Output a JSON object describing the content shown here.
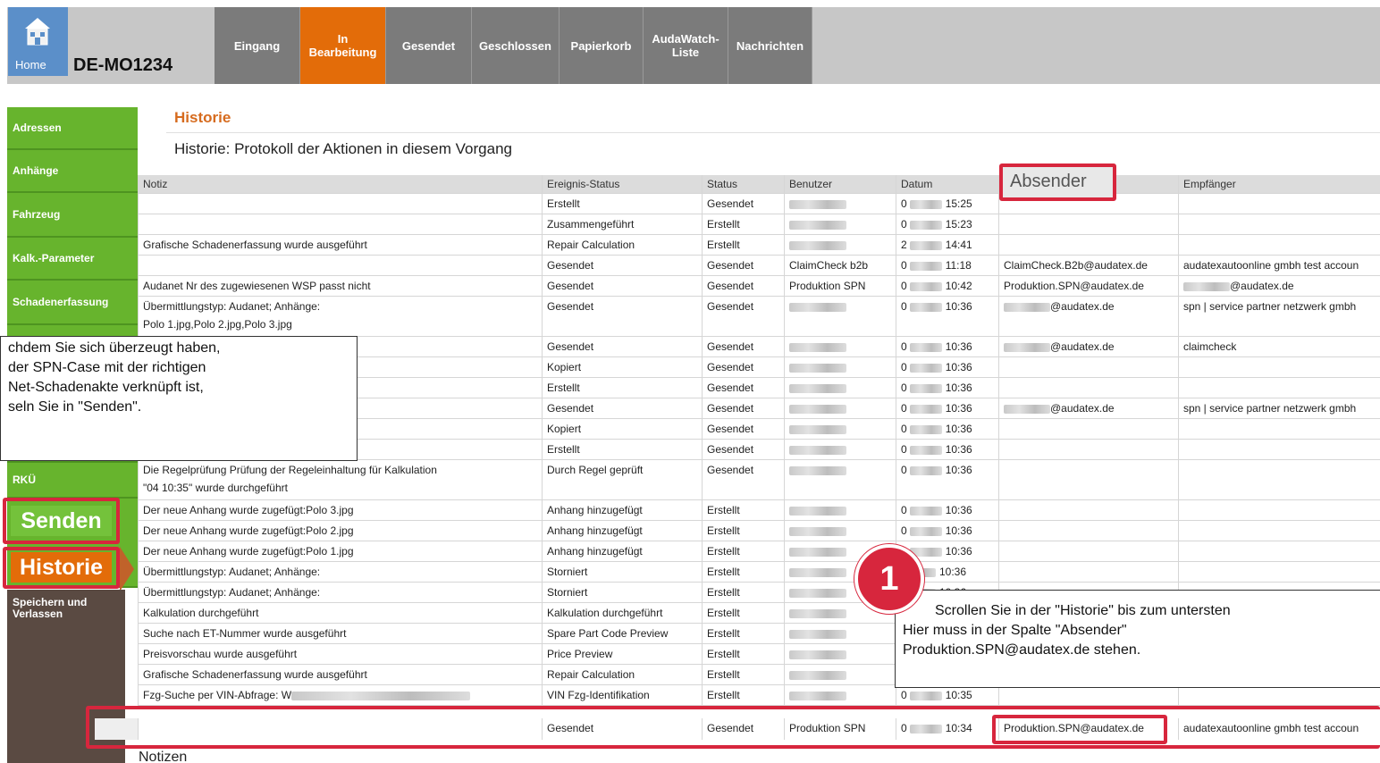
{
  "home_label": "Home",
  "case_id": "DE-MO1234",
  "nav_tabs": [
    {
      "label": "Eingang"
    },
    {
      "label": "In\nBearbeitung"
    },
    {
      "label": "Gesendet"
    },
    {
      "label": "Geschlossen"
    },
    {
      "label": "Papierkorb"
    },
    {
      "label": "AudaWatch-\nListe"
    },
    {
      "label": "Nachrichten"
    }
  ],
  "sidebar": {
    "items": [
      "Adressen",
      "Anhänge",
      "Fahrzeug",
      "Kalk.-Parameter",
      "Schadenerfassung",
      "RKÜ"
    ],
    "senden": "Senden",
    "historie": "Historie",
    "speichern": "Speichern und\nVerlassen"
  },
  "content": {
    "title": "Historie",
    "subtitle": "Historie: Protokoll der Aktionen in diesem Vorgang",
    "notizen": "Notizen"
  },
  "table": {
    "headers": [
      "Notiz",
      "Ereignis-Status",
      "Status",
      "Benutzer",
      "Datum",
      "",
      "Empfänger"
    ],
    "rows": [
      {
        "notiz": "",
        "ereignis": "Erstellt",
        "status": "Gesendet",
        "benutzer": "",
        "datum_pre": "0",
        "zeit": "15:25",
        "absender": "",
        "empfaenger": ""
      },
      {
        "notiz": "",
        "ereignis": "Zusammengeführt",
        "status": "Erstellt",
        "benutzer": "",
        "datum_pre": "0",
        "zeit": "15:23",
        "absender": "",
        "empfaenger": ""
      },
      {
        "notiz": "Grafische Schadenerfassung wurde ausgeführt",
        "ereignis": "Repair Calculation",
        "status": "Erstellt",
        "benutzer": "",
        "datum_pre": "2",
        "zeit": "14:41",
        "absender": "",
        "empfaenger": ""
      },
      {
        "notiz": "",
        "ereignis": "Gesendet",
        "status": "Gesendet",
        "benutzer": "ClaimCheck b2b",
        "datum_pre": "0",
        "zeit": "11:18",
        "absender": "ClaimCheck.B2b@audatex.de",
        "empfaenger": "audatexautoonline gmbh test accoun"
      },
      {
        "notiz": "Audanet Nr des zugewiesenen WSP passt nicht",
        "ereignis": "Gesendet",
        "status": "Gesendet",
        "benutzer": "Produktion SPN",
        "datum_pre": "0",
        "zeit": "10:42",
        "absender": "Produktion.SPN@audatex.de",
        "empfaenger": "@audatex.de"
      },
      {
        "notiz": "Übermittlungstyp: Audanet; Anhänge:",
        "notiz2": "Polo 1.jpg,Polo 2.jpg,Polo 3.jpg",
        "ereignis": "Gesendet",
        "status": "Gesendet",
        "benutzer": "",
        "datum_pre": "0",
        "zeit": "10:36",
        "absender": "@audatex.de",
        "empfaenger": "spn | service partner netzwerk gmbh"
      },
      {
        "notiz": "",
        "ereignis": "Gesendet",
        "status": "Gesendet",
        "benutzer": "",
        "datum_pre": "0",
        "zeit": "10:36",
        "absender": "@audatex.de",
        "empfaenger": "claimcheck"
      },
      {
        "notiz": "",
        "ereignis": "Kopiert",
        "status": "Gesendet",
        "benutzer": "",
        "datum_pre": "0",
        "zeit": "10:36",
        "absender": "",
        "empfaenger": ""
      },
      {
        "notiz": "",
        "ereignis": "Erstellt",
        "status": "Gesendet",
        "benutzer": "",
        "datum_pre": "0",
        "zeit": "10:36",
        "absender": "",
        "empfaenger": ""
      },
      {
        "notiz": "",
        "ereignis": "Gesendet",
        "status": "Gesendet",
        "benutzer": "",
        "datum_pre": "0",
        "zeit": "10:36",
        "absender": "@audatex.de",
        "empfaenger": "spn | service partner netzwerk gmbh"
      },
      {
        "notiz": "",
        "ereignis": "Kopiert",
        "status": "Gesendet",
        "benutzer": "",
        "datum_pre": "0",
        "zeit": "10:36",
        "absender": "",
        "empfaenger": ""
      },
      {
        "notiz": "",
        "ereignis": "Erstellt",
        "status": "Gesendet",
        "benutzer": "",
        "datum_pre": "0",
        "zeit": "10:36",
        "absender": "",
        "empfaenger": ""
      },
      {
        "notiz": "Die Regelprüfung Prüfung der Regeleinhaltung für Kalkulation",
        "notiz2": "\"04        10:35\" wurde durchgeführt",
        "ereignis": "Durch Regel geprüft",
        "status": "Gesendet",
        "benutzer": "",
        "datum_pre": "0",
        "zeit": "10:36",
        "absender": "",
        "empfaenger": ""
      },
      {
        "notiz": "Der neue Anhang wurde zugefügt:Polo 3.jpg",
        "ereignis": "Anhang hinzugefügt",
        "status": "Erstellt",
        "benutzer": "",
        "datum_pre": "0",
        "zeit": "10:36",
        "absender": "",
        "empfaenger": ""
      },
      {
        "notiz": "Der neue Anhang wurde zugefügt:Polo 2.jpg",
        "ereignis": "Anhang hinzugefügt",
        "status": "Erstellt",
        "benutzer": "",
        "datum_pre": "0",
        "zeit": "10:36",
        "absender": "",
        "empfaenger": ""
      },
      {
        "notiz": "Der neue Anhang wurde zugefügt:Polo 1.jpg",
        "ereignis": "Anhang hinzugefügt",
        "status": "Erstellt",
        "benutzer": "",
        "datum_pre": "0",
        "zeit": "10:36",
        "absender": "",
        "empfaenger": ""
      },
      {
        "notiz": "Übermittlungstyp: Audanet; Anhänge:",
        "ereignis": "Storniert",
        "status": "Erstellt",
        "benutzer": "",
        "datum_pre": "",
        "zeit": "10:36",
        "absender": "",
        "empfaenger": ""
      },
      {
        "notiz": "Übermittlungstyp: Audanet; Anhänge:",
        "ereignis": "Storniert",
        "status": "Erstellt",
        "benutzer": "",
        "datum_pre": "",
        "zeit": "10:36",
        "absender": "",
        "empfaenger": ""
      },
      {
        "notiz": "Kalkulation durchgeführt",
        "ereignis": "Kalkulation durchgeführt",
        "status": "Erstellt",
        "benutzer": "",
        "datum_pre": "",
        "zeit": "",
        "absender": "",
        "empfaenger": ""
      },
      {
        "notiz": "Suche nach ET-Nummer wurde ausgeführt",
        "ereignis": "Spare Part Code Preview",
        "status": "Erstellt",
        "benutzer": "",
        "datum_pre": "",
        "zeit": "",
        "absender": "",
        "empfaenger": ""
      },
      {
        "notiz": "Preisvorschau wurde ausgeführt",
        "ereignis": "Price Preview",
        "status": "Erstellt",
        "benutzer": "",
        "datum_pre": "",
        "zeit": "",
        "absender": "",
        "empfaenger": ""
      },
      {
        "notiz": "Grafische Schadenerfassung wurde ausgeführt",
        "ereignis": "Repair Calculation",
        "status": "Erstellt",
        "benutzer": "",
        "datum_pre": "",
        "zeit": "",
        "absender": "",
        "empfaenger": ""
      },
      {
        "notiz": "Fzg-Suche per VIN-Abfrage: W",
        "ereignis": "VIN Fzg-Identifikation",
        "status": "Erstellt",
        "benutzer": "",
        "datum_pre": "0",
        "zeit": "10:35",
        "absender": "",
        "empfaenger": ""
      }
    ],
    "last_row": {
      "notiz": "",
      "ereignis": "Gesendet",
      "status": "Gesendet",
      "benutzer": "Produktion SPN",
      "datum_pre": "0",
      "zeit": "10:34",
      "absender": "Produktion.SPN@audatex.de",
      "empfaenger": "audatexautoonline gmbh test accoun"
    }
  },
  "annotations": {
    "absender_label": "Absender",
    "badge": "1",
    "callout_left": [
      "chdem Sie sich überzeugt haben,",
      "der SPN-Case mit der richtigen",
      "Net-Schadenakte verknüpft ist,",
      "seln Sie in \"Senden\"."
    ],
    "callout_right": [
      "Scrollen Sie in der \"Historie\" bis zum untersten",
      "Hier muss in der Spalte \"Absender\"",
      "Produktion.SPN@audatex.de stehen."
    ],
    "accent_color": "#d7263d"
  }
}
